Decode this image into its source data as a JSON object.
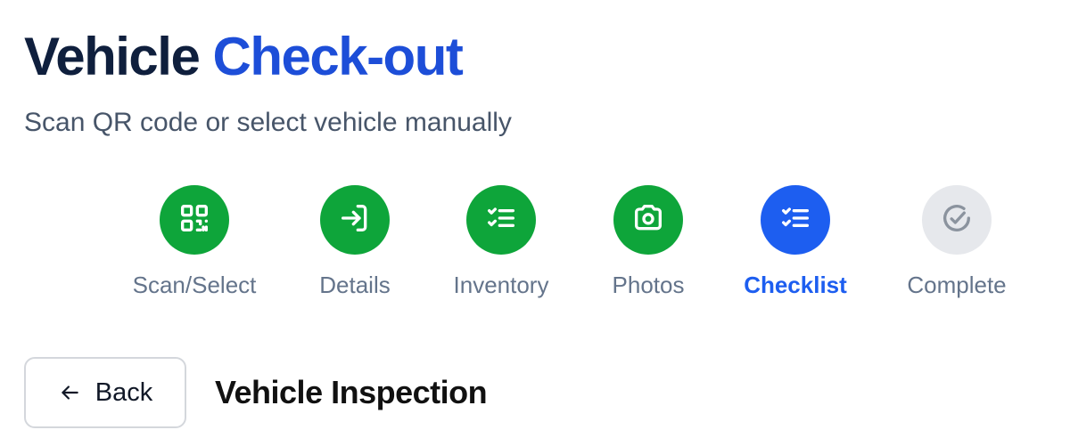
{
  "header": {
    "title_part1": "Vehicle",
    "title_part2": "Check-out",
    "subtitle": "Scan QR code or select vehicle manually"
  },
  "steps": [
    {
      "label": "Scan/Select",
      "status": "completed",
      "icon": "qr-code-icon"
    },
    {
      "label": "Details",
      "status": "completed",
      "icon": "sign-in-icon"
    },
    {
      "label": "Inventory",
      "status": "completed",
      "icon": "checklist-icon"
    },
    {
      "label": "Photos",
      "status": "completed",
      "icon": "camera-icon"
    },
    {
      "label": "Checklist",
      "status": "current",
      "icon": "checklist-icon"
    },
    {
      "label": "Complete",
      "status": "pending",
      "icon": "check-circle-icon"
    }
  ],
  "back_button": {
    "label": "Back",
    "icon": "arrow-left-icon"
  },
  "section": {
    "heading": "Vehicle Inspection"
  },
  "colors": {
    "title_dark": "#0f1f3d",
    "title_accent": "#1d4ed8",
    "step_completed": "#0ea53a",
    "step_current": "#1d5ef0",
    "step_pending": "#e6e8ec"
  }
}
